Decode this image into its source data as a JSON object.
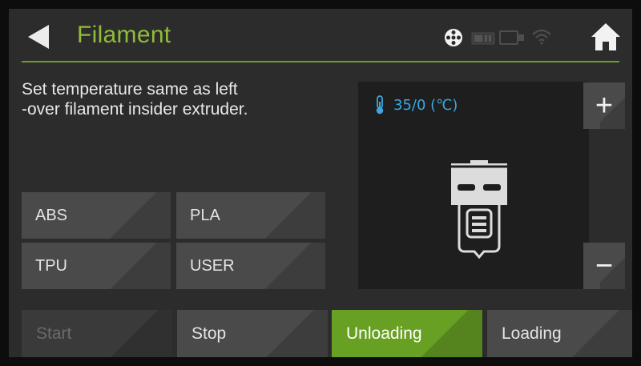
{
  "header": {
    "title": "Filament",
    "icons": [
      "back-icon",
      "reel-icon",
      "card-icon",
      "usb-icon",
      "wifi-icon",
      "home-icon"
    ]
  },
  "message": {
    "line1": "Set temperature same as left",
    "line2": "-over filament insider extruder."
  },
  "materials": [
    "ABS",
    "PLA",
    "TPU",
    "USER"
  ],
  "extruder": {
    "temperature": "35/0 (℃)",
    "plus_label": "+",
    "minus_label": "−"
  },
  "actions": {
    "start": "Start",
    "stop": "Stop",
    "unloading": "Unloading",
    "loading": "Loading"
  },
  "colors": {
    "accent": "#8fbc3a",
    "active": "#68a023",
    "temperature": "#3aa7e0",
    "button": "#4a4a4a",
    "background": "#2c2c2c"
  }
}
